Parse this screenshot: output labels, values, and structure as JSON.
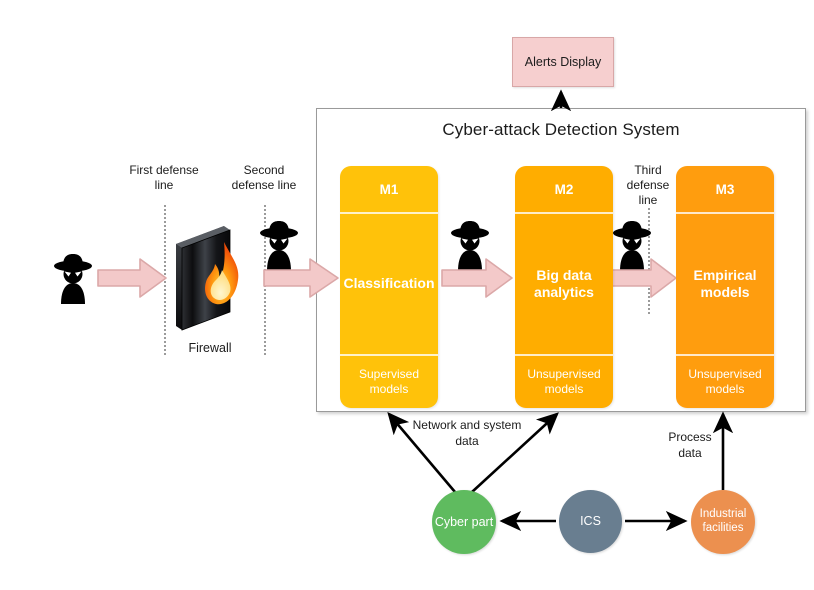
{
  "diagram": {
    "title": "Cyber-attack Detection System",
    "alerts": {
      "label": "Alerts Display"
    },
    "modules": [
      {
        "id": "M1",
        "head": "M1",
        "body": "Classification",
        "foot": "Supervised models",
        "color": "#ffc20a"
      },
      {
        "id": "M2",
        "head": "M2",
        "body": "Big data analytics",
        "foot": "Unsupervised models",
        "color": "#ffad00"
      },
      {
        "id": "M3",
        "head": "M3",
        "body": "Empirical models",
        "foot": "Unsupervised models",
        "color": "#ff9d0e"
      }
    ],
    "defense_lines": [
      {
        "label": "First defense line"
      },
      {
        "label": "Second defense line"
      },
      {
        "label": "Third defense line"
      }
    ],
    "firewall": {
      "label": "Firewall"
    },
    "nodes": [
      {
        "id": "cyber-part",
        "label": "Cyber part",
        "color": "#5fbb5f"
      },
      {
        "id": "ics",
        "label": "ICS",
        "color": "#697e90"
      },
      {
        "id": "industrial-facilities",
        "label": "Industrial facilities",
        "color": "#ec904f"
      }
    ],
    "flows": [
      {
        "id": "network-system-data",
        "label": "Network and system data"
      },
      {
        "id": "process-data",
        "label": "Process data"
      }
    ],
    "icons": {
      "attacker": "hacker-icon",
      "firewall": "firewall-icon",
      "attack_arrow": "attack-arrow-icon",
      "alert_arrow": "arrow-up-icon"
    },
    "colors": {
      "attack_arrow_fill": "#f3c9c9",
      "attack_arrow_stroke": "#d9a0a0",
      "alerts_fill": "#f6cfcf",
      "frame_border": "#9a9a9a",
      "data_arrow": "#000000"
    }
  }
}
